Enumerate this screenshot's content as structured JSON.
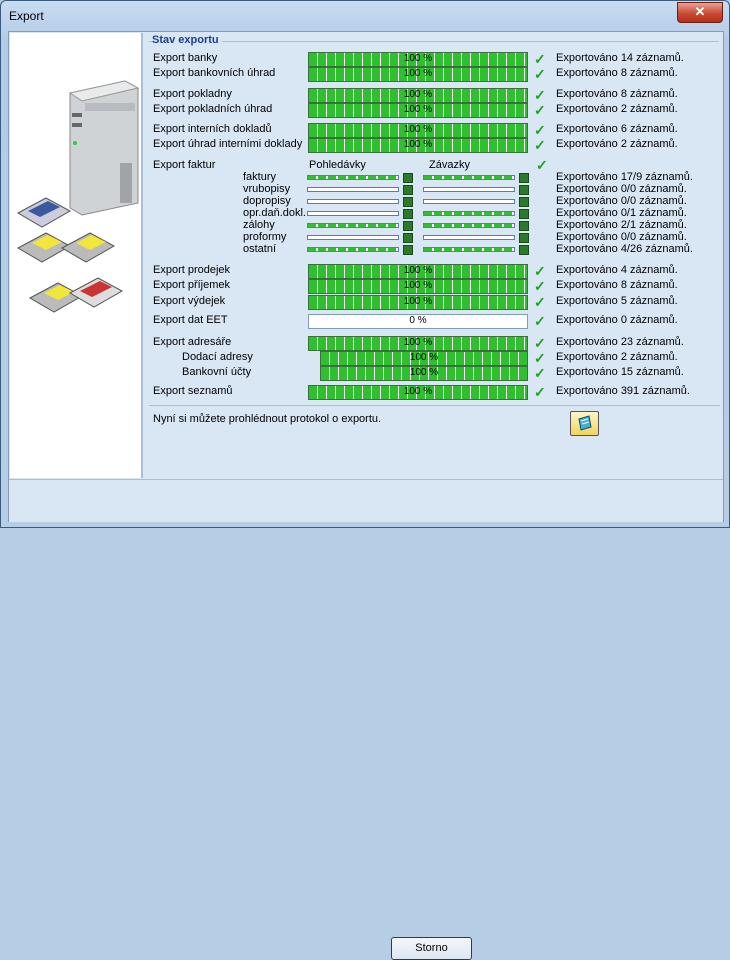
{
  "window": {
    "title": "Export",
    "close_label": "✕"
  },
  "group_title": "Stav exportu",
  "rows": [
    {
      "label": "Export banky",
      "percent": "100 %",
      "status": "Exportováno 14 záznamů."
    },
    {
      "label": "Export bankovních úhrad",
      "percent": "100 %",
      "status": "Exportováno 8 záznamů."
    },
    {
      "label": "Export pokladny",
      "percent": "100 %",
      "status": "Exportováno 8 záznamů."
    },
    {
      "label": "Export pokladních úhrad",
      "percent": "100 %",
      "status": "Exportováno 2 záznamů."
    },
    {
      "label": "Export interních dokladů",
      "percent": "100 %",
      "status": "Exportováno 6 záznamů."
    },
    {
      "label": "Export úhrad interními doklady",
      "percent": "100 %",
      "status": "Exportováno 2 záznamů."
    }
  ],
  "faktury": {
    "label": "Export faktur",
    "col1": "Pohledávky",
    "col2": "Závazky",
    "items": [
      {
        "label": "faktury",
        "status": "Exportováno 17/9 záznamů."
      },
      {
        "label": "vrubopisy",
        "status": "Exportováno 0/0 záznamů."
      },
      {
        "label": "dopropisy",
        "status": "Exportováno 0/0 záznamů."
      },
      {
        "label": "opr.daň.dokl.",
        "status": "Exportováno 0/1 záznamů."
      },
      {
        "label": "zálohy",
        "status": "Exportováno 2/1 záznamů."
      },
      {
        "label": "proformy",
        "status": "Exportováno 0/0 záznamů."
      },
      {
        "label": "ostatní",
        "status": "Exportováno 4/26 záznamů."
      }
    ]
  },
  "rows2": [
    {
      "label": "Export prodejek",
      "percent": "100 %",
      "status": "Exportováno 4 záznamů."
    },
    {
      "label": "Export příjemek",
      "percent": "100 %",
      "status": "Exportováno 8 záznamů."
    },
    {
      "label": "Export výdejek",
      "percent": "100 %",
      "status": "Exportováno 5 záznamů."
    },
    {
      "label": "Export dat EET",
      "percent": "0 %",
      "status": "Exportováno 0 záznamů."
    },
    {
      "label": "Export adresáře",
      "percent": "100 %",
      "status": "Exportováno 23 záznamů."
    },
    {
      "label": "Dodací adresy",
      "percent": "100 %",
      "status": "Exportováno 2 záznamů."
    },
    {
      "label": "Bankovní účty",
      "percent": "100 %",
      "status": "Exportováno 15 záznamů."
    },
    {
      "label": "Export seznamů",
      "percent": "100 %",
      "status": "Exportováno 391 záznamů."
    }
  ],
  "protocol_text": "Nyní si můžete prohlédnout protokol o exportu.",
  "storno_label": "Storno",
  "colors": {
    "progress": "#2ec02e",
    "check": "#1fa31f",
    "title": "#1a3f8e"
  }
}
